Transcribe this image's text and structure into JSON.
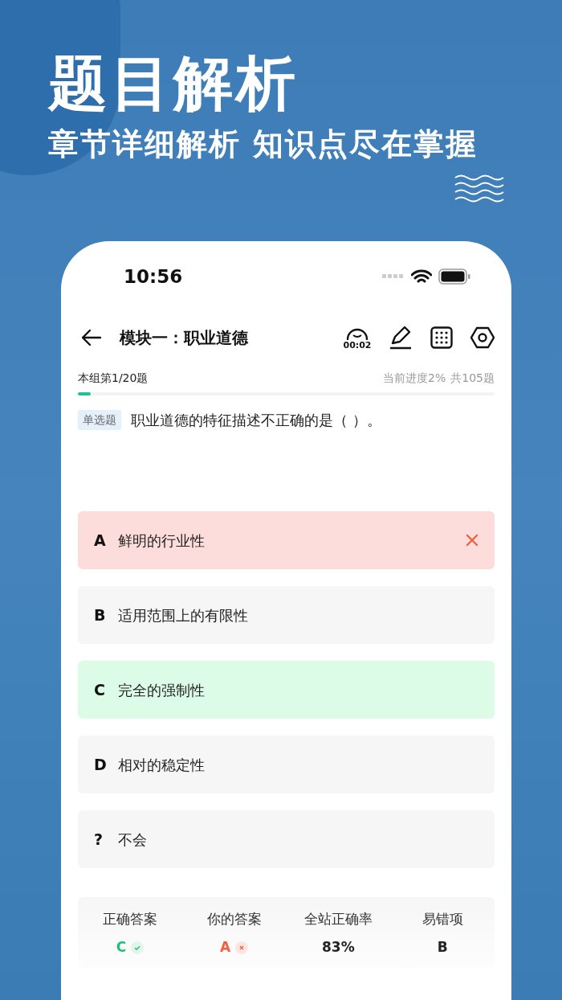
{
  "headline": "题目解析",
  "subtitle": "章节详细解析 知识点尽在掌握",
  "status_bar": {
    "time": "10:56"
  },
  "header": {
    "title": "模块一：职业道德",
    "timer": "00:02"
  },
  "progress": {
    "group": "本组第1/20题",
    "overall": "当前进度2%",
    "total": "共105题",
    "level": 0.03
  },
  "question": {
    "tag": "单选题",
    "text": "职业道德的特征描述不正确的是（ ）。"
  },
  "options": [
    {
      "letter": "A",
      "text": "鲜明的行业性",
      "kind": "wrong"
    },
    {
      "letter": "B",
      "text": "适用范围上的有限性",
      "kind": "normal"
    },
    {
      "letter": "C",
      "text": "完全的强制性",
      "kind": "correct"
    },
    {
      "letter": "D",
      "text": "相对的稳定性",
      "kind": "normal"
    },
    {
      "letter": "?",
      "text": "不会",
      "kind": "normal"
    }
  ],
  "stats": [
    {
      "label": "正确答案",
      "value": "C",
      "kind": "correct"
    },
    {
      "label": "你的答案",
      "value": "A",
      "kind": "wrong"
    },
    {
      "label": "全站正确率",
      "value": "83%",
      "kind": "plain"
    },
    {
      "label": "易错项",
      "value": "B",
      "kind": "plain"
    }
  ]
}
